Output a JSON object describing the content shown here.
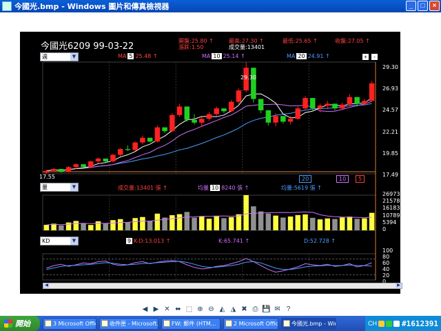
{
  "window": {
    "title": "今國光.bmp - Windows 圖片和傳真檢視器",
    "buttons": [
      "_",
      "□",
      "×"
    ]
  },
  "stock": {
    "title": "今國光6209 99-03-22",
    "open": "開盤:25.80 ↑",
    "high": "最高:27.30 ↑",
    "low": "最低:25.65 ↑",
    "close": "收盤:27.05 ↑",
    "change": "漲跌:1.50",
    "volume": "成交量:13401"
  },
  "price_panel": {
    "period_select": "週",
    "ma5": "5",
    "ma5_val": "25.48 ↑",
    "ma10": "10",
    "ma10_val": "25.14 ↑",
    "ma20": "20",
    "ma20_val": "24.91 ↑",
    "peak_label": "29.30",
    "low_label": "17.55",
    "axis": [
      "29.30",
      "26.93",
      "24.57",
      "22.21",
      "19.85",
      "17.49"
    ],
    "markers": [
      "20",
      "10",
      "5"
    ]
  },
  "volume_panel": {
    "select": "量",
    "vol_label": "成交量:13401 張 ↑",
    "ma_a": "10",
    "ma_a_val": "8240 張 ↑",
    "ma_b_label": "均量:",
    "ma_b_val": "5619 張 ↑",
    "axis": [
      "26973",
      "21578",
      "16183",
      "10789",
      "5394",
      "0"
    ]
  },
  "kd_panel": {
    "select": "KD",
    "period": "9",
    "kd": "K-D:13.013 ↑",
    "k": "K:65.741 ↑",
    "d": "D:52.728 ↑",
    "axis": [
      "100",
      "80",
      "60",
      "40",
      "20",
      "0"
    ]
  },
  "viewer_toolbar": [
    "◀",
    "▶",
    "✕",
    "⬌",
    "⬚",
    "⊕",
    "⊖",
    "◭",
    "◮",
    "✖",
    "⎙",
    "💾",
    "✉",
    "?"
  ],
  "taskbar": {
    "start": "開始",
    "tasks": [
      "3 Microsoft Office...",
      "收件匣 - Microsoft...",
      "FW: 郵件 (HTM...",
      "2 Microsoft Offic...",
      "今國光.bmp - Win..."
    ],
    "tray_text": "CH",
    "stamp": "#1612391"
  },
  "colors": {
    "up": "#ff2020",
    "down": "#20d020",
    "ma5": "#ffffff",
    "ma10": "#d070ff",
    "ma20": "#4aa0ff",
    "vol": "#ffff40"
  },
  "chart_data": {
    "type": "candlestick",
    "title": "今國光6209 99-03-22",
    "candles": [
      [
        17.6,
        17.9,
        17.5,
        17.8
      ],
      [
        17.8,
        18.1,
        17.7,
        18.0
      ],
      [
        18.0,
        17.9,
        17.6,
        17.7
      ],
      [
        17.7,
        18.3,
        17.6,
        18.2
      ],
      [
        18.2,
        18.6,
        18.0,
        18.5
      ],
      [
        18.5,
        18.4,
        18.1,
        18.2
      ],
      [
        18.2,
        18.9,
        18.1,
        18.8
      ],
      [
        18.8,
        19.2,
        18.6,
        19.1
      ],
      [
        19.1,
        19.0,
        18.7,
        18.8
      ],
      [
        18.8,
        19.6,
        18.7,
        19.5
      ],
      [
        19.5,
        20.2,
        19.3,
        20.1
      ],
      [
        20.1,
        20.5,
        19.9,
        20.0
      ],
      [
        20.0,
        20.9,
        19.9,
        20.8
      ],
      [
        20.8,
        21.5,
        20.6,
        21.3
      ],
      [
        21.3,
        21.2,
        20.8,
        20.9
      ],
      [
        20.9,
        22.6,
        20.8,
        22.4
      ],
      [
        22.4,
        22.3,
        21.8,
        22.0
      ],
      [
        22.0,
        23.9,
        21.9,
        23.7
      ],
      [
        23.7,
        24.9,
        23.5,
        24.6
      ],
      [
        24.6,
        24.5,
        23.0,
        23.2
      ],
      [
        23.2,
        23.8,
        22.7,
        22.9
      ],
      [
        22.9,
        23.5,
        22.5,
        23.3
      ],
      [
        23.3,
        24.0,
        23.1,
        23.8
      ],
      [
        23.8,
        24.6,
        23.6,
        24.4
      ],
      [
        24.4,
        24.3,
        23.9,
        24.1
      ],
      [
        24.1,
        25.3,
        24.0,
        25.1
      ],
      [
        25.1,
        26.5,
        24.9,
        26.3
      ],
      [
        26.3,
        29.3,
        26.1,
        28.7
      ],
      [
        28.7,
        28.5,
        25.0,
        25.4
      ],
      [
        25.4,
        25.3,
        23.9,
        24.2
      ],
      [
        24.2,
        24.0,
        22.6,
        22.9
      ],
      [
        22.9,
        23.9,
        22.5,
        23.6
      ],
      [
        23.6,
        23.4,
        22.8,
        23.0
      ],
      [
        23.0,
        23.6,
        22.7,
        23.3
      ],
      [
        23.3,
        24.6,
        23.2,
        24.4
      ],
      [
        24.4,
        25.7,
        24.2,
        25.5
      ],
      [
        25.5,
        25.3,
        24.1,
        24.4
      ],
      [
        24.4,
        24.9,
        24.0,
        24.7
      ],
      [
        24.7,
        25.2,
        24.3,
        24.9
      ],
      [
        24.9,
        24.6,
        24.2,
        24.4
      ],
      [
        24.4,
        25.0,
        24.3,
        24.8
      ],
      [
        24.8,
        25.9,
        24.6,
        25.6
      ],
      [
        25.6,
        25.4,
        24.6,
        24.9
      ],
      [
        24.9,
        25.4,
        24.7,
        25.2
      ],
      [
        25.2,
        27.3,
        25.65,
        27.05
      ]
    ],
    "volumes": [
      4200,
      5100,
      3800,
      6000,
      7200,
      5600,
      4100,
      6900,
      5200,
      7800,
      8600,
      6100,
      9400,
      10200,
      7100,
      12800,
      9800,
      11600,
      12400,
      14100,
      9700,
      10800,
      8900,
      11200,
      9300,
      10100,
      12300,
      26973,
      18400,
      14500,
      12900,
      11300,
      9800,
      10600,
      11700,
      12200,
      9600,
      8400,
      9100,
      8700,
      9900,
      10500,
      8800,
      9200,
      13401
    ],
    "k": [
      45,
      55,
      60,
      52,
      58,
      65,
      62,
      70,
      72,
      60,
      55,
      58,
      66,
      70,
      62,
      68,
      72,
      74,
      70,
      58,
      48,
      42,
      45,
      52,
      55,
      62,
      70,
      82,
      70,
      55,
      40,
      30,
      35,
      42,
      50,
      62,
      58,
      55,
      60,
      52,
      55,
      62,
      50,
      55,
      65.741
    ],
    "d": [
      40,
      46,
      52,
      55,
      56,
      58,
      60,
      63,
      66,
      64,
      60,
      58,
      60,
      63,
      64,
      66,
      68,
      70,
      71,
      67,
      60,
      52,
      48,
      49,
      52,
      55,
      60,
      68,
      70,
      65,
      55,
      45,
      40,
      40,
      44,
      50,
      53,
      54,
      56,
      55,
      55,
      57,
      55,
      55,
      52.728
    ],
    "ylim": [
      17.49,
      29.3
    ]
  }
}
